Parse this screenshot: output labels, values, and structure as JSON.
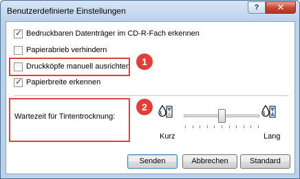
{
  "window": {
    "title": "Benutzerdefinierte Einstellungen",
    "help_label": "?",
    "close_label": "✕"
  },
  "options": [
    {
      "label": "Bedruckbaren Datenträger im CD-R-Fach erkennen",
      "checked": true
    },
    {
      "label": "Papierabrieb verhindern",
      "checked": false
    },
    {
      "label": "Druckköpfe manuell ausrichten",
      "checked": false
    },
    {
      "label": "Papierbreite erkennen",
      "checked": true
    }
  ],
  "annotations": {
    "badge1": "1",
    "badge2": "2",
    "color": "#e0403a"
  },
  "drying": {
    "label": "Wartezeit für Tintentrocknung:",
    "min_label": "Kurz",
    "max_label": "Lang",
    "slider_position": 0.5,
    "min_icon": "water-drop-short-icon",
    "max_icon": "water-drop-long-icon"
  },
  "buttons": {
    "send": "Senden",
    "cancel": "Abbrechen",
    "standard": "Standard"
  }
}
